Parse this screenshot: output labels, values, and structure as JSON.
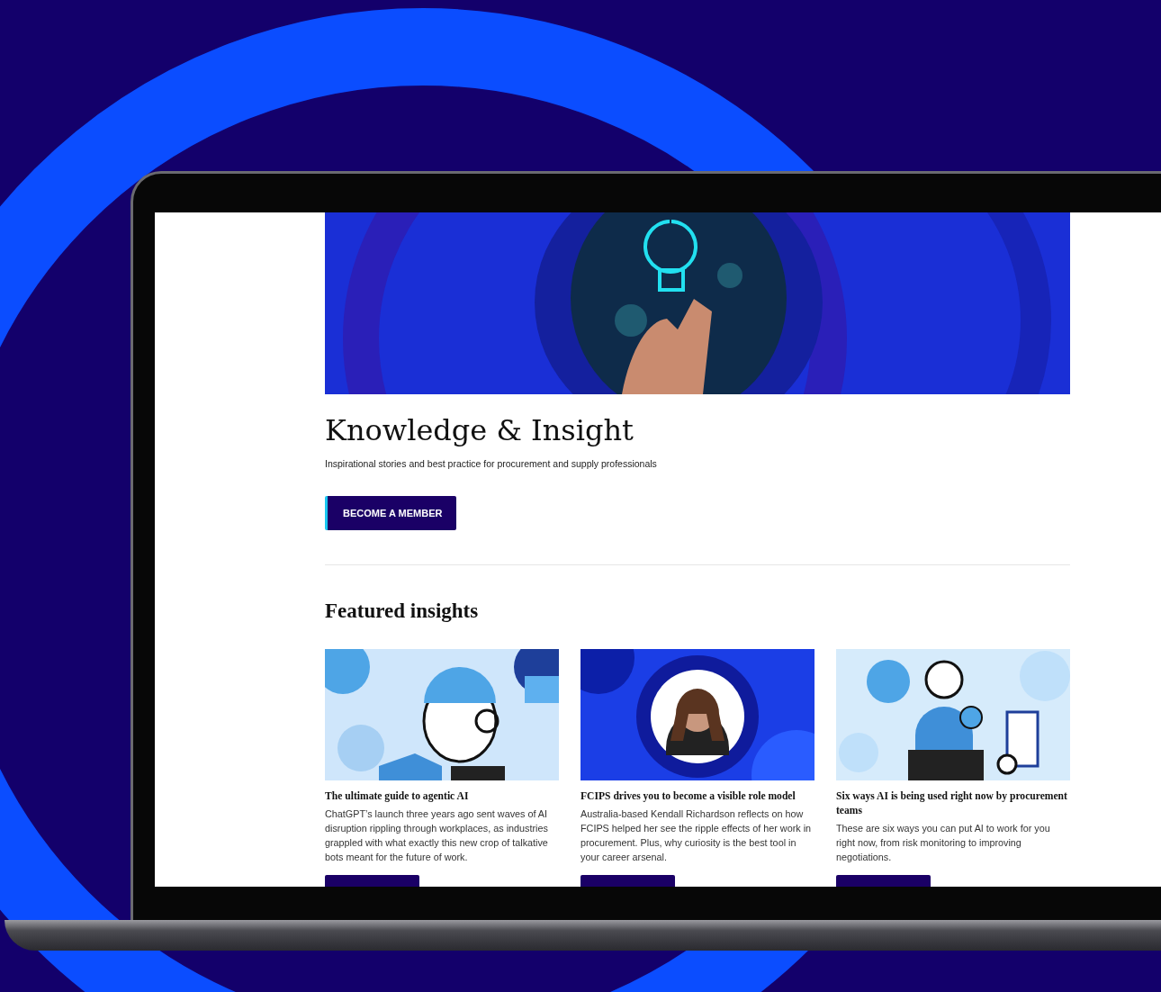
{
  "page": {
    "title": "Knowledge & Insight",
    "subtitle": "Inspirational stories and best practice for procurement and supply professionals",
    "cta": "BECOME A MEMBER"
  },
  "featured": {
    "title": "Featured insights",
    "cards": [
      {
        "title": "The ultimate guide to agentic AI",
        "description": "ChatGPT’s launch three years ago sent waves of AI disruption rippling through workplaces, as industries grappled with what exactly this new crop of talkative bots meant for the future of work."
      },
      {
        "title": "FCIPS drives you to become a visible role model",
        "description": "Australia-based Kendall Richardson reflects on how FCIPS helped her see the ripple effects of her work in procurement. Plus, why curiosity is the best tool in your career arsenal."
      },
      {
        "title": "Six ways AI is being used right now by procurement teams",
        "description": "These are six ways you can put AI to work for you right now, from risk monitoring to improving negotiations."
      }
    ]
  }
}
